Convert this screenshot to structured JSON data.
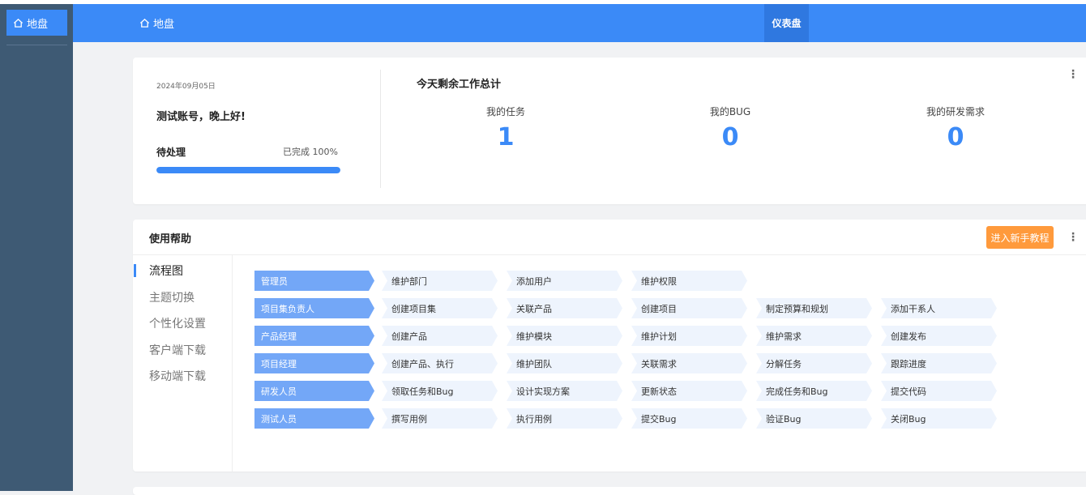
{
  "sidebar": {
    "home_label": "地盘"
  },
  "header": {
    "breadcrumb": "地盘",
    "active_tab": "仪表盘"
  },
  "summary": {
    "date": "2024年09月05日",
    "greeting": "测试账号，晚上好!",
    "pending_label": "待处理",
    "completed_label": "已完成 100%",
    "progress_percent": 100,
    "title": "今天剩余工作总计",
    "stats": [
      {
        "label": "我的任务",
        "value": "1"
      },
      {
        "label": "我的BUG",
        "value": "0"
      },
      {
        "label": "我的研发需求",
        "value": "0"
      }
    ],
    "more": "⋮"
  },
  "help": {
    "title": "使用帮助",
    "tutorial_button": "进入新手教程",
    "more": "⋮",
    "nav": [
      "流程图",
      "主题切换",
      "个性化设置",
      "客户端下载",
      "移动端下载"
    ],
    "flow": [
      {
        "role": "管理员",
        "steps": [
          "维护部门",
          "添加用户",
          "维护权限"
        ]
      },
      {
        "role": "项目集负责人",
        "steps": [
          "创建项目集",
          "关联产品",
          "创建项目",
          "制定预算和规划",
          "添加干系人"
        ]
      },
      {
        "role": "产品经理",
        "steps": [
          "创建产品",
          "维护模块",
          "维护计划",
          "维护需求",
          "创建发布"
        ]
      },
      {
        "role": "项目经理",
        "steps": [
          "创建产品、执行",
          "维护团队",
          "关联需求",
          "分解任务",
          "跟踪进度"
        ]
      },
      {
        "role": "研发人员",
        "steps": [
          "领取任务和Bug",
          "设计实现方案",
          "更新状态",
          "完成任务和Bug",
          "提交代码"
        ]
      },
      {
        "role": "测试人员",
        "steps": [
          "撰写用例",
          "执行用例",
          "提交Bug",
          "验证Bug",
          "关闭Bug"
        ]
      }
    ]
  },
  "colors": {
    "primary": "#3b8af7",
    "sidebar": "#3e5a74",
    "accent_orange": "#ff9a3c",
    "role_bg": "#73a7f7",
    "step_bg": "#eef4fd"
  },
  "icons": {
    "home": "home-icon",
    "more": "more-vertical-icon"
  }
}
